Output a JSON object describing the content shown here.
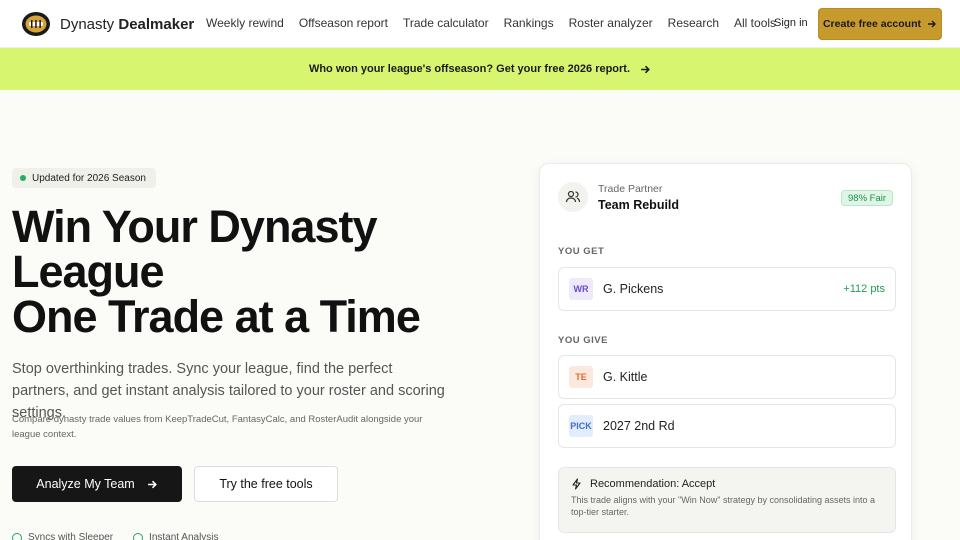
{
  "brand": {
    "name_prefix": "Dynasty",
    "name_suffix": "Dealmaker"
  },
  "nav": {
    "links": [
      "Weekly rewind",
      "Offseason report",
      "Trade calculator",
      "Rankings",
      "Roster analyzer",
      "Research",
      "All tools"
    ],
    "sign_in": "Sign in",
    "create_account": "Create free account"
  },
  "banner": {
    "text": "Who won your league's offseason? Get your free 2026 report."
  },
  "hero": {
    "badge": "Updated for 2026 Season",
    "title_lines": [
      "Win Your Dynasty",
      "League",
      "One Trade at a Time"
    ],
    "subtitle": "Stop overthinking trades. Sync your league, find the perfect partners, and get instant analysis tailored to your roster and scoring settings.",
    "note": "Compare dynasty trade values from KeepTradeCut, FantasyCalc, and RosterAudit alongside your league context.",
    "primary_button": "Analyze My Team",
    "secondary_button": "Try the free tools",
    "features": [
      "Syncs with Sleeper",
      "Instant Analysis"
    ]
  },
  "card": {
    "partner_label": "Trade Partner",
    "partner_name": "Team Rebuild",
    "fairness": "98% Fair",
    "you_get_label": "YOU GET",
    "you_get": [
      {
        "pos": "WR",
        "player": "G. Pickens",
        "pts": "+112 pts"
      }
    ],
    "you_give_label": "YOU GIVE",
    "you_give": [
      {
        "pos": "TE",
        "player": "G. Kittle"
      },
      {
        "pos": "PICK",
        "player": "2027 2nd Rd"
      }
    ],
    "recommendation_title": "Recommendation: Accept",
    "recommendation_text": "This trade aligns with your \"Win Now\" strategy by consolidating assets into a top-tier starter."
  },
  "colors": {
    "banner_bg": "#d7f56f",
    "cta_bg": "#c79a2e",
    "primary_btn_bg": "#161616",
    "fair_green": "#1f8f4b"
  }
}
